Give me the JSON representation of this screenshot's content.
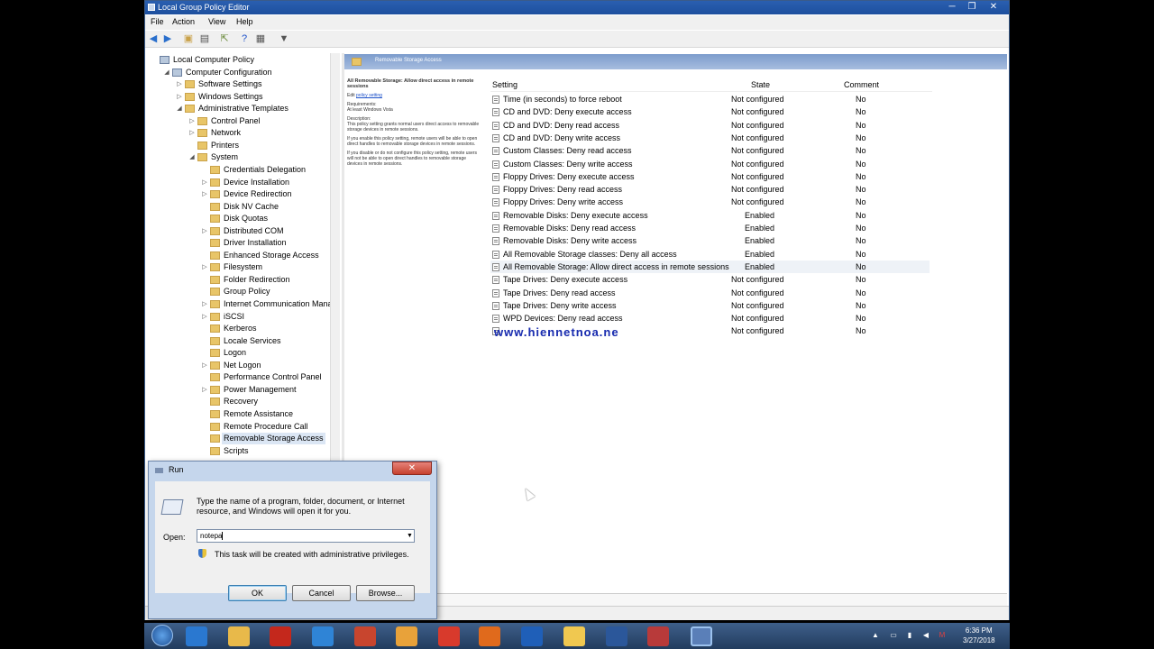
{
  "window": {
    "title": "Local Group Policy Editor",
    "minimize": "─",
    "maximize": "❐",
    "close": "✕"
  },
  "menu": [
    "File",
    "Action",
    "View",
    "Help"
  ],
  "tree": [
    {
      "label": "Local Computer Policy",
      "level": 0,
      "exp": ""
    },
    {
      "label": "Computer Configuration",
      "level": 1,
      "exp": "◢"
    },
    {
      "label": "Software Settings",
      "level": 2,
      "exp": "▷"
    },
    {
      "label": "Windows Settings",
      "level": 2,
      "exp": "▷"
    },
    {
      "label": "Administrative Templates",
      "level": 2,
      "exp": "◢"
    },
    {
      "label": "Control Panel",
      "level": 3,
      "exp": "▷"
    },
    {
      "label": "Network",
      "level": 3,
      "exp": "▷"
    },
    {
      "label": "Printers",
      "level": 3,
      "exp": ""
    },
    {
      "label": "System",
      "level": 3,
      "exp": "◢"
    },
    {
      "label": "Credentials Delegation",
      "level": 4,
      "exp": ""
    },
    {
      "label": "Device Installation",
      "level": 4,
      "exp": "▷"
    },
    {
      "label": "Device Redirection",
      "level": 4,
      "exp": "▷"
    },
    {
      "label": "Disk NV Cache",
      "level": 4,
      "exp": ""
    },
    {
      "label": "Disk Quotas",
      "level": 4,
      "exp": ""
    },
    {
      "label": "Distributed COM",
      "level": 4,
      "exp": "▷"
    },
    {
      "label": "Driver Installation",
      "level": 4,
      "exp": ""
    },
    {
      "label": "Enhanced Storage Access",
      "level": 4,
      "exp": ""
    },
    {
      "label": "Filesystem",
      "level": 4,
      "exp": "▷"
    },
    {
      "label": "Folder Redirection",
      "level": 4,
      "exp": ""
    },
    {
      "label": "Group Policy",
      "level": 4,
      "exp": ""
    },
    {
      "label": "Internet Communication Manage",
      "level": 4,
      "exp": "▷"
    },
    {
      "label": "iSCSI",
      "level": 4,
      "exp": "▷"
    },
    {
      "label": "Kerberos",
      "level": 4,
      "exp": ""
    },
    {
      "label": "Locale Services",
      "level": 4,
      "exp": ""
    },
    {
      "label": "Logon",
      "level": 4,
      "exp": ""
    },
    {
      "label": "Net Logon",
      "level": 4,
      "exp": "▷"
    },
    {
      "label": "Performance Control Panel",
      "level": 4,
      "exp": ""
    },
    {
      "label": "Power Management",
      "level": 4,
      "exp": "▷"
    },
    {
      "label": "Recovery",
      "level": 4,
      "exp": ""
    },
    {
      "label": "Remote Assistance",
      "level": 4,
      "exp": ""
    },
    {
      "label": "Remote Procedure Call",
      "level": 4,
      "exp": ""
    },
    {
      "label": "Removable Storage Access",
      "level": 4,
      "exp": "",
      "selected": true
    },
    {
      "label": "Scripts",
      "level": 4,
      "exp": ""
    }
  ],
  "details": {
    "header": "Removable Storage Access",
    "desc_title": "All Removable Storage: Allow direct access in remote sessions",
    "edit_prefix": "Edit",
    "edit_link": "policy setting",
    "requirements_label": "Requirements:",
    "requirements": "At least Windows Vista",
    "description_label": "Description:",
    "desc_p1": "This policy setting grants normal users direct access to removable storage devices in remote sessions.",
    "desc_p2": "If you enable this policy setting, remote users will be able to open direct handles to removable storage devices in remote sessions.",
    "desc_p3": "If you disable or do not configure this policy setting, remote users will not be able to open direct handles to removable storage devices in remote sessions."
  },
  "columns": {
    "setting": "Setting",
    "state": "State",
    "comment": "Comment"
  },
  "policies": [
    {
      "setting": "Time (in seconds) to force reboot",
      "state": "Not configured",
      "comment": "No"
    },
    {
      "setting": "CD and DVD: Deny execute access",
      "state": "Not configured",
      "comment": "No"
    },
    {
      "setting": "CD and DVD: Deny read access",
      "state": "Not configured",
      "comment": "No"
    },
    {
      "setting": "CD and DVD: Deny write access",
      "state": "Not configured",
      "comment": "No"
    },
    {
      "setting": "Custom Classes: Deny read access",
      "state": "Not configured",
      "comment": "No"
    },
    {
      "setting": "Custom Classes: Deny write access",
      "state": "Not configured",
      "comment": "No"
    },
    {
      "setting": "Floppy Drives: Deny execute access",
      "state": "Not configured",
      "comment": "No"
    },
    {
      "setting": "Floppy Drives: Deny read access",
      "state": "Not configured",
      "comment": "No"
    },
    {
      "setting": "Floppy Drives: Deny write access",
      "state": "Not configured",
      "comment": "No"
    },
    {
      "setting": "Removable Disks: Deny execute access",
      "state": "Enabled",
      "comment": "No"
    },
    {
      "setting": "Removable Disks: Deny read access",
      "state": "Enabled",
      "comment": "No"
    },
    {
      "setting": "Removable Disks: Deny write access",
      "state": "Enabled",
      "comment": "No"
    },
    {
      "setting": "All Removable Storage classes: Deny all access",
      "state": "Enabled",
      "comment": "No"
    },
    {
      "setting": "All Removable Storage: Allow direct access in remote sessions",
      "state": "Enabled",
      "comment": "No",
      "highlight": true
    },
    {
      "setting": "Tape Drives: Deny execute access",
      "state": "Not configured",
      "comment": "No"
    },
    {
      "setting": "Tape Drives: Deny read access",
      "state": "Not configured",
      "comment": "No"
    },
    {
      "setting": "Tape Drives: Deny write access",
      "state": "Not configured",
      "comment": "No"
    },
    {
      "setting": "WPD Devices: Deny read access",
      "state": "Not configured",
      "comment": "No"
    },
    {
      "setting": "",
      "state": "Not configured",
      "comment": "No"
    }
  ],
  "watermark": "www.hiennetnoa.ne",
  "run": {
    "title": "Run",
    "close": "✕",
    "description": "Type the name of a program, folder, document, or Internet resource, and Windows will open it for you.",
    "open_label": "Open:",
    "open_value": "notepa",
    "admin_note": "This task will be created with administrative privileges.",
    "ok": "OK",
    "cancel": "Cancel",
    "browse": "Browse..."
  },
  "taskbar": {
    "time": "6:36 PM",
    "date": "3/27/2018",
    "apps": [
      "ie-icon",
      "explorer-icon",
      "acrobat-icon",
      "edge-icon",
      "tool-icon",
      "folder-icon",
      "chrome-icon",
      "firefox-icon",
      "outlook-icon",
      "files-icon",
      "word-icon",
      "briefcase-icon",
      "run-icon"
    ],
    "colors": {
      "ie-icon": "#2a78d0",
      "explorer-icon": "#e8b94a",
      "acrobat-icon": "#c4281c",
      "edge-icon": "#2f84d6",
      "tool-icon": "#c8452e",
      "folder-icon": "#e8a23a",
      "chrome-icon": "#d83a2c",
      "firefox-icon": "#e06a1c",
      "outlook-icon": "#1f5fb8",
      "files-icon": "#f0c850",
      "word-icon": "#2b579a",
      "briefcase-icon": "#b83a3a",
      "run-icon": "#5a7fb8"
    }
  }
}
